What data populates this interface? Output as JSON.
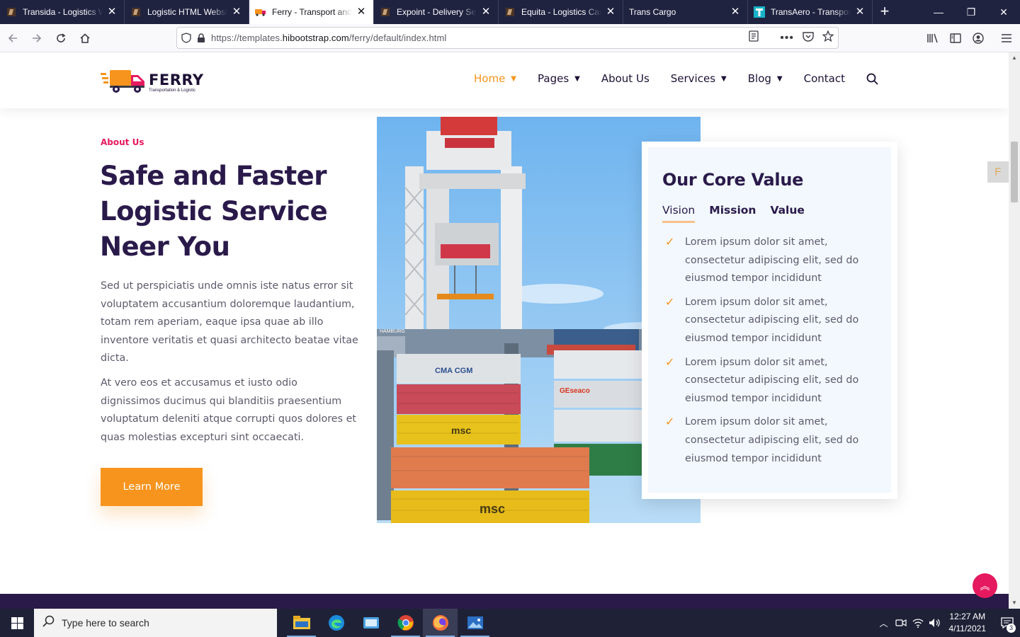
{
  "browser": {
    "tabs": [
      {
        "title": "Transida - Logistics W",
        "favicon": "bootstrap-favicon",
        "active": false
      },
      {
        "title": "Logistic HTML Websit",
        "favicon": "bootstrap-favicon",
        "active": false
      },
      {
        "title": "Ferry - Transport and L",
        "favicon": "truck-favicon",
        "active": true
      },
      {
        "title": "Expoint - Delivery Ser",
        "favicon": "bootstrap-favicon",
        "active": false
      },
      {
        "title": "Equita - Logistics Carg",
        "favicon": "bootstrap-favicon",
        "active": false
      },
      {
        "title": "Trans Cargo",
        "favicon": "none",
        "active": false
      },
      {
        "title": "TransAero - Transport",
        "favicon": "t-favicon",
        "active": false
      }
    ],
    "url_prefix": "https://templates.",
    "url_domain": "hibootstrap.com",
    "url_path": "/ferry/default/index.html"
  },
  "site": {
    "logo_name": "FERRY",
    "logo_tagline": "Transportation & Logistic",
    "nav": [
      {
        "label": "Home",
        "has_dropdown": true,
        "active": true
      },
      {
        "label": "Pages",
        "has_dropdown": true,
        "active": false
      },
      {
        "label": "About Us",
        "has_dropdown": false,
        "active": false
      },
      {
        "label": "Services",
        "has_dropdown": true,
        "active": false
      },
      {
        "label": "Blog",
        "has_dropdown": true,
        "active": false
      },
      {
        "label": "Contact",
        "has_dropdown": false,
        "active": false
      }
    ],
    "accent_color": "#f7941d",
    "heading_color": "#2a1a4a",
    "label_color": "#e5195f"
  },
  "about": {
    "label": "About Us",
    "heading": "Safe and Faster Logistic Service Neer You",
    "para1": "Sed ut perspiciatis unde omnis iste natus error sit voluptatem accusantium doloremque laudantium, totam rem aperiam, eaque ipsa quae ab illo inventore veritatis et quasi architecto beatae vitae dicta.",
    "para2": "At vero eos et accusamus et iusto odio dignissimos ducimus qui blanditiis praesentium voluptatum deleniti atque corrupti quos dolores et quas molestias excepturi sint occaecati.",
    "button": "Learn More"
  },
  "photo": {
    "container_labels": [
      "CMA CGM",
      "msc",
      "GEseaco",
      "msc",
      "HAMBURG"
    ]
  },
  "core_value": {
    "title": "Our Core Value",
    "tabs": [
      "Vision",
      "Mission",
      "Value"
    ],
    "active_tab": "Vision",
    "items": [
      "Lorem ipsum dolor sit amet, consectetur adipiscing elit, sed do eiusmod tempor incididunt",
      "Lorem ipsum dolor sit amet, consectetur adipiscing elit, sed do eiusmod tempor incididunt",
      "Lorem ipsum dolor sit amet, consectetur adipiscing elit, sed do eiusmod tempor incididunt",
      "Lorem ipsum dolor sit amet, consectetur adipiscing elit, sed do eiusmod tempor incididunt"
    ]
  },
  "taskbar": {
    "search_placeholder": "Type here to search",
    "apps": [
      "file-explorer-icon",
      "edge-icon",
      "app-window-icon",
      "chrome-icon",
      "firefox-icon",
      "photos-icon"
    ],
    "time": "12:27 AM",
    "date": "4/11/2021",
    "notification_count": "3"
  }
}
